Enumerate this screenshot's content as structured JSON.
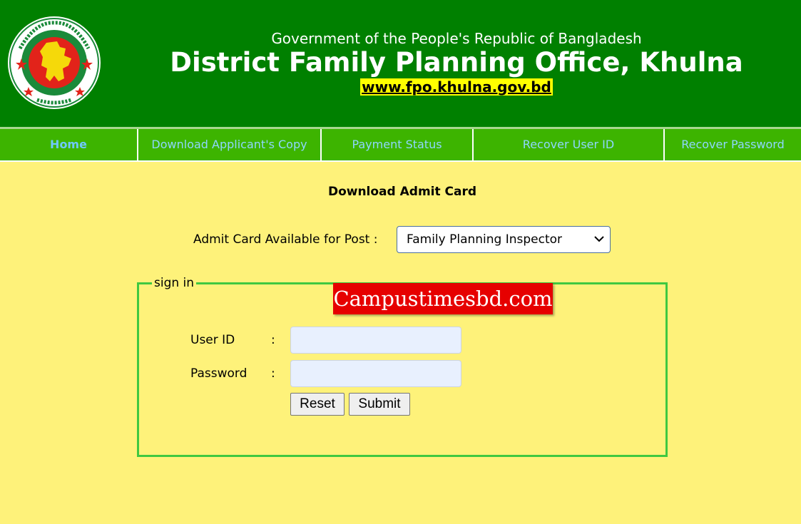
{
  "header": {
    "government_line": "Government of the People's Republic of Bangladesh",
    "office_title": "District Family Planning Office, Khulna",
    "website": "www.fpo.khulna.gov.bd",
    "seal_icon": "bangladesh-government-seal-icon"
  },
  "nav": {
    "items": [
      {
        "label": "Home",
        "active": true
      },
      {
        "label": "Download Applicant's Copy",
        "active": false
      },
      {
        "label": "Payment Status",
        "active": false
      },
      {
        "label": "Recover User ID",
        "active": false
      },
      {
        "label": "Recover Password",
        "active": false
      }
    ]
  },
  "main": {
    "heading": "Download Admit Card",
    "post_label": "Admit Card Available for Post :",
    "post_selected": "Family Planning Inspector"
  },
  "signin": {
    "legend": "sign in",
    "user_id_label": "User ID",
    "password_label": "Password",
    "colon": ":",
    "user_id_value": "",
    "password_value": "",
    "reset_label": "Reset",
    "submit_label": "Submit"
  },
  "watermark": "Campustimesbd.com",
  "colors": {
    "header_green": "#008000",
    "nav_green": "#3db400",
    "page_yellow": "#fef27a",
    "fieldset_border": "#40c840",
    "watermark_red": "#e60000"
  }
}
